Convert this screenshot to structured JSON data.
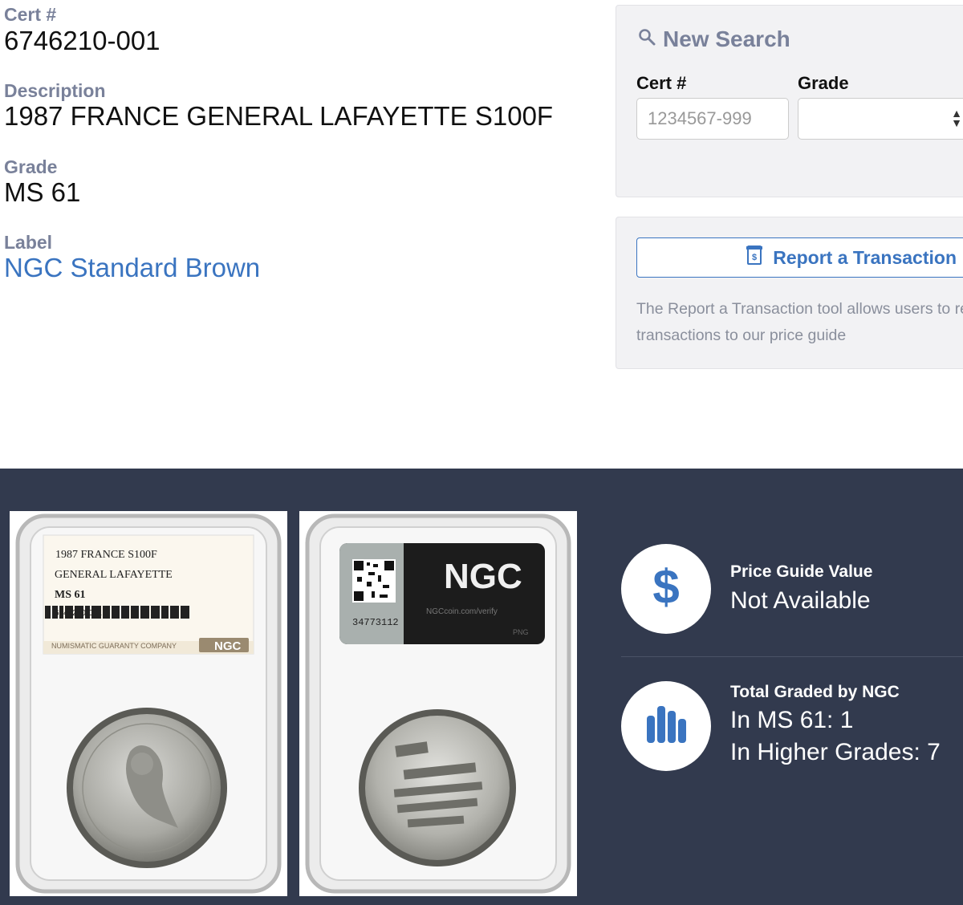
{
  "cert": {
    "label": "Cert #",
    "value": "6746210-001"
  },
  "description": {
    "label": "Description",
    "value": "1987 FRANCE GENERAL LAFAYETTE S100F"
  },
  "grade": {
    "label": "Grade",
    "value": "MS 61"
  },
  "label_field": {
    "label": "Label",
    "value": "NGC Standard Brown"
  },
  "new_search": {
    "title": "New Search",
    "cert_label": "Cert #",
    "cert_placeholder": "1234567-999",
    "grade_label": "Grade",
    "grade_selected": ""
  },
  "report": {
    "button_label": "Report a Transaction",
    "description": "The Report a Transaction tool allows users to report private or public transactions to our price guide"
  },
  "slab_obverse": {
    "line1": "1987 FRANCE S100F",
    "line2": "GENERAL LAFAYETTE",
    "line3": "MS 61",
    "line4": "6746210-001",
    "footer": "NUMISMATIC GUARANTY COMPANY",
    "logo": "NGC"
  },
  "slab_reverse": {
    "logo": "NGC",
    "serial": "34773112",
    "verify": "NGCcoin.com/verify",
    "png": "PNG"
  },
  "price_guide": {
    "heading": "Price Guide Value",
    "value": "Not Available"
  },
  "total_graded": {
    "heading": "Total Graded by NGC",
    "in_grade": "In MS 61: 1",
    "higher": "In Higher Grades: 7"
  },
  "colors": {
    "accent": "#3a74c0",
    "dark_bg": "#323a4e",
    "label_gray": "#79819a"
  },
  "icons": [
    "search-icon",
    "receipt-icon",
    "dollar-icon",
    "bar-chart-icon",
    "select-arrows-icon"
  ]
}
